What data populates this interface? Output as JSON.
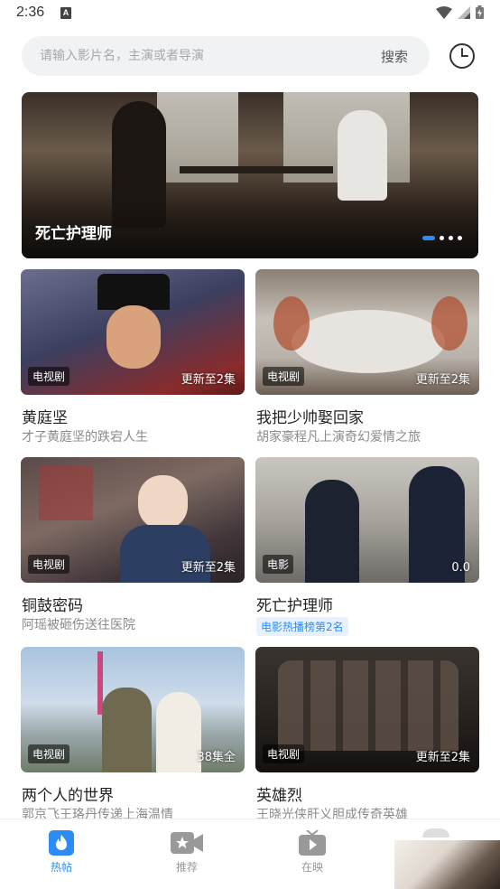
{
  "status_bar": {
    "time": "2:36",
    "notification_icon": "A"
  },
  "search": {
    "placeholder": "请输入影片名，主演或者导演",
    "button_label": "搜索"
  },
  "banner": {
    "title": "死亡护理师",
    "slides": 4,
    "active_slide": 1
  },
  "cards": [
    {
      "name": "黄庭坚",
      "desc": "才子黄庭坚的跌宕人生",
      "tag": "电视剧",
      "update": "更新至2集"
    },
    {
      "name": "我把少帅娶回家",
      "desc": "胡家豪程凡上演奇幻爱情之旅",
      "tag": "电视剧",
      "update": "更新至2集"
    },
    {
      "name": "铜鼓密码",
      "desc": "阿瑶被砸伤送往医院",
      "tag": "电视剧",
      "update": "更新至2集"
    },
    {
      "name": "死亡护理师",
      "rank": "电影热播榜第2名",
      "tag": "电影",
      "update": "0.0"
    },
    {
      "name": "两个人的世界",
      "desc": "郭京飞王珞丹传递上海温情",
      "tag": "电视剧",
      "update": "38集全"
    },
    {
      "name": "英雄烈",
      "desc": "王晓光侠肝义胆成传奇英雄",
      "tag": "电视剧",
      "update": "更新至2集"
    }
  ],
  "tabs": [
    {
      "label": "热帖",
      "icon": "flame-icon",
      "active": true
    },
    {
      "label": "推荐",
      "icon": "video-star-icon",
      "active": false
    },
    {
      "label": "在映",
      "icon": "tv-play-icon",
      "active": false
    }
  ],
  "colors": {
    "accent": "#2c8cf4",
    "search_bg": "#f1f2f4",
    "desc_text": "#8a8a8a"
  }
}
